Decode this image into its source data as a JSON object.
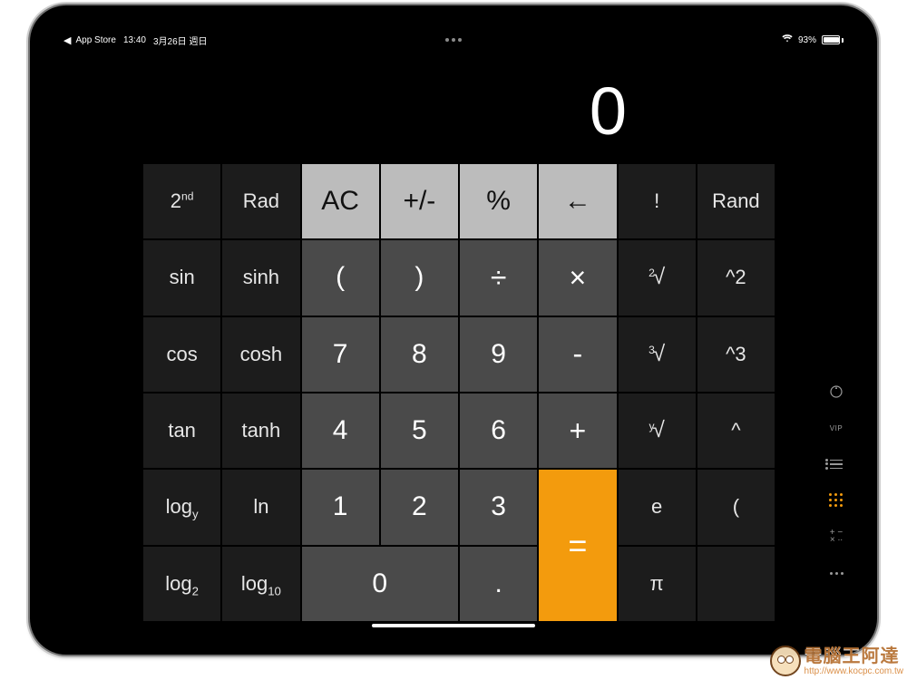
{
  "statusbar": {
    "back_app": "App Store",
    "time": "13:40",
    "date": "3月26日 週日",
    "battery_percent": "93%"
  },
  "display": {
    "value": "0"
  },
  "keys": {
    "second": "2",
    "second_sup": "nd",
    "rad": "Rad",
    "ac": "AC",
    "plusminus": "+/-",
    "percent": "%",
    "back": "←",
    "factorial": "!",
    "rand": "Rand",
    "sin": "sin",
    "sinh": "sinh",
    "lparen": "(",
    "rparen": ")",
    "div": "÷",
    "mul": "×",
    "root2_pre": "2",
    "root_sym": "√",
    "pow2": "^2",
    "cos": "cos",
    "cosh": "cosh",
    "d7": "7",
    "d8": "8",
    "d9": "9",
    "minus": "-",
    "root3_pre": "3",
    "pow3": "^3",
    "tan": "tan",
    "tanh": "tanh",
    "d4": "4",
    "d5": "5",
    "d6": "6",
    "plus": "+",
    "rooty_pre": "y",
    "powy": "^",
    "logy_base": "log",
    "logy_sub": "y",
    "ln": "ln",
    "d1": "1",
    "d2": "2",
    "d3": "3",
    "equals": "=",
    "e": "e",
    "lparen2": "(",
    "log2_base": "log",
    "log2_sub": "2",
    "log10_base": "log",
    "log10_sub": "10",
    "d0": "0",
    "dot": ".",
    "pi": "π"
  },
  "sidebar": {
    "vip": "VIP"
  },
  "watermark": {
    "title": "電腦王阿達",
    "url": "http://www.kocpc.com.tw"
  }
}
